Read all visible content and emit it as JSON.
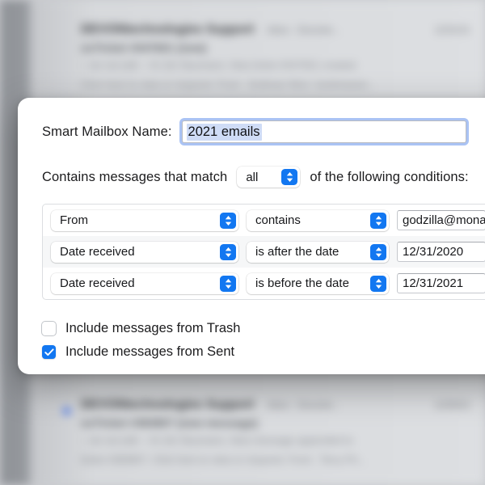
{
  "backdrop": {
    "rows": [
      {
        "sender": "DEVONtechnologies Support",
        "meta": "inbox - Devonte...",
        "date": "12/31/21",
        "subject": "osTicket #047601 (new)",
        "snippet_line1": "-- do not edit -- Hi Jim Neumann, New ticket #047601 created.",
        "snippet_line2": "Click here to view or respond. From : Andreas Woo <andreaswo...",
        "unread": false
      },
      {
        "sender": "DEVONtechnologies Support",
        "meta": "inbox - Devonte...",
        "date": "12/30/21",
        "subject": "osTicket #383807 (new message)",
        "snippet_line1": "-- do not edit -- Hi Jim Neumann, New message appended to",
        "snippet_line2": "ticket #383807. Click here to view or respond. From : Terry Pri...",
        "unread": true
      }
    ]
  },
  "sheet": {
    "name_label": "Smart Mailbox Name:",
    "name_value": "2021 emails",
    "name_placeholder": "Smart Mailbox Name",
    "match_prefix": "Contains messages that match",
    "match_selected": "all",
    "match_suffix": "of the following conditions:",
    "conditions": [
      {
        "field": "From",
        "operator": "contains",
        "value": "godzilla@monarchmedia.com",
        "value_placeholder": ""
      },
      {
        "field": "Date received",
        "operator": "is after the date",
        "value": "12/31/2020",
        "value_placeholder": ""
      },
      {
        "field": "Date received",
        "operator": "is before the date",
        "value": "12/31/2021",
        "value_placeholder": ""
      }
    ],
    "options": [
      {
        "label": "Include messages from Trash",
        "checked": false
      },
      {
        "label": "Include messages from Sent",
        "checked": true
      }
    ]
  },
  "colors": {
    "accent": "#1277f1",
    "selection": "#cfdcf6",
    "focus_ring": "rgba(100,145,235,.55)",
    "unread_dot": "#3b6df0"
  }
}
